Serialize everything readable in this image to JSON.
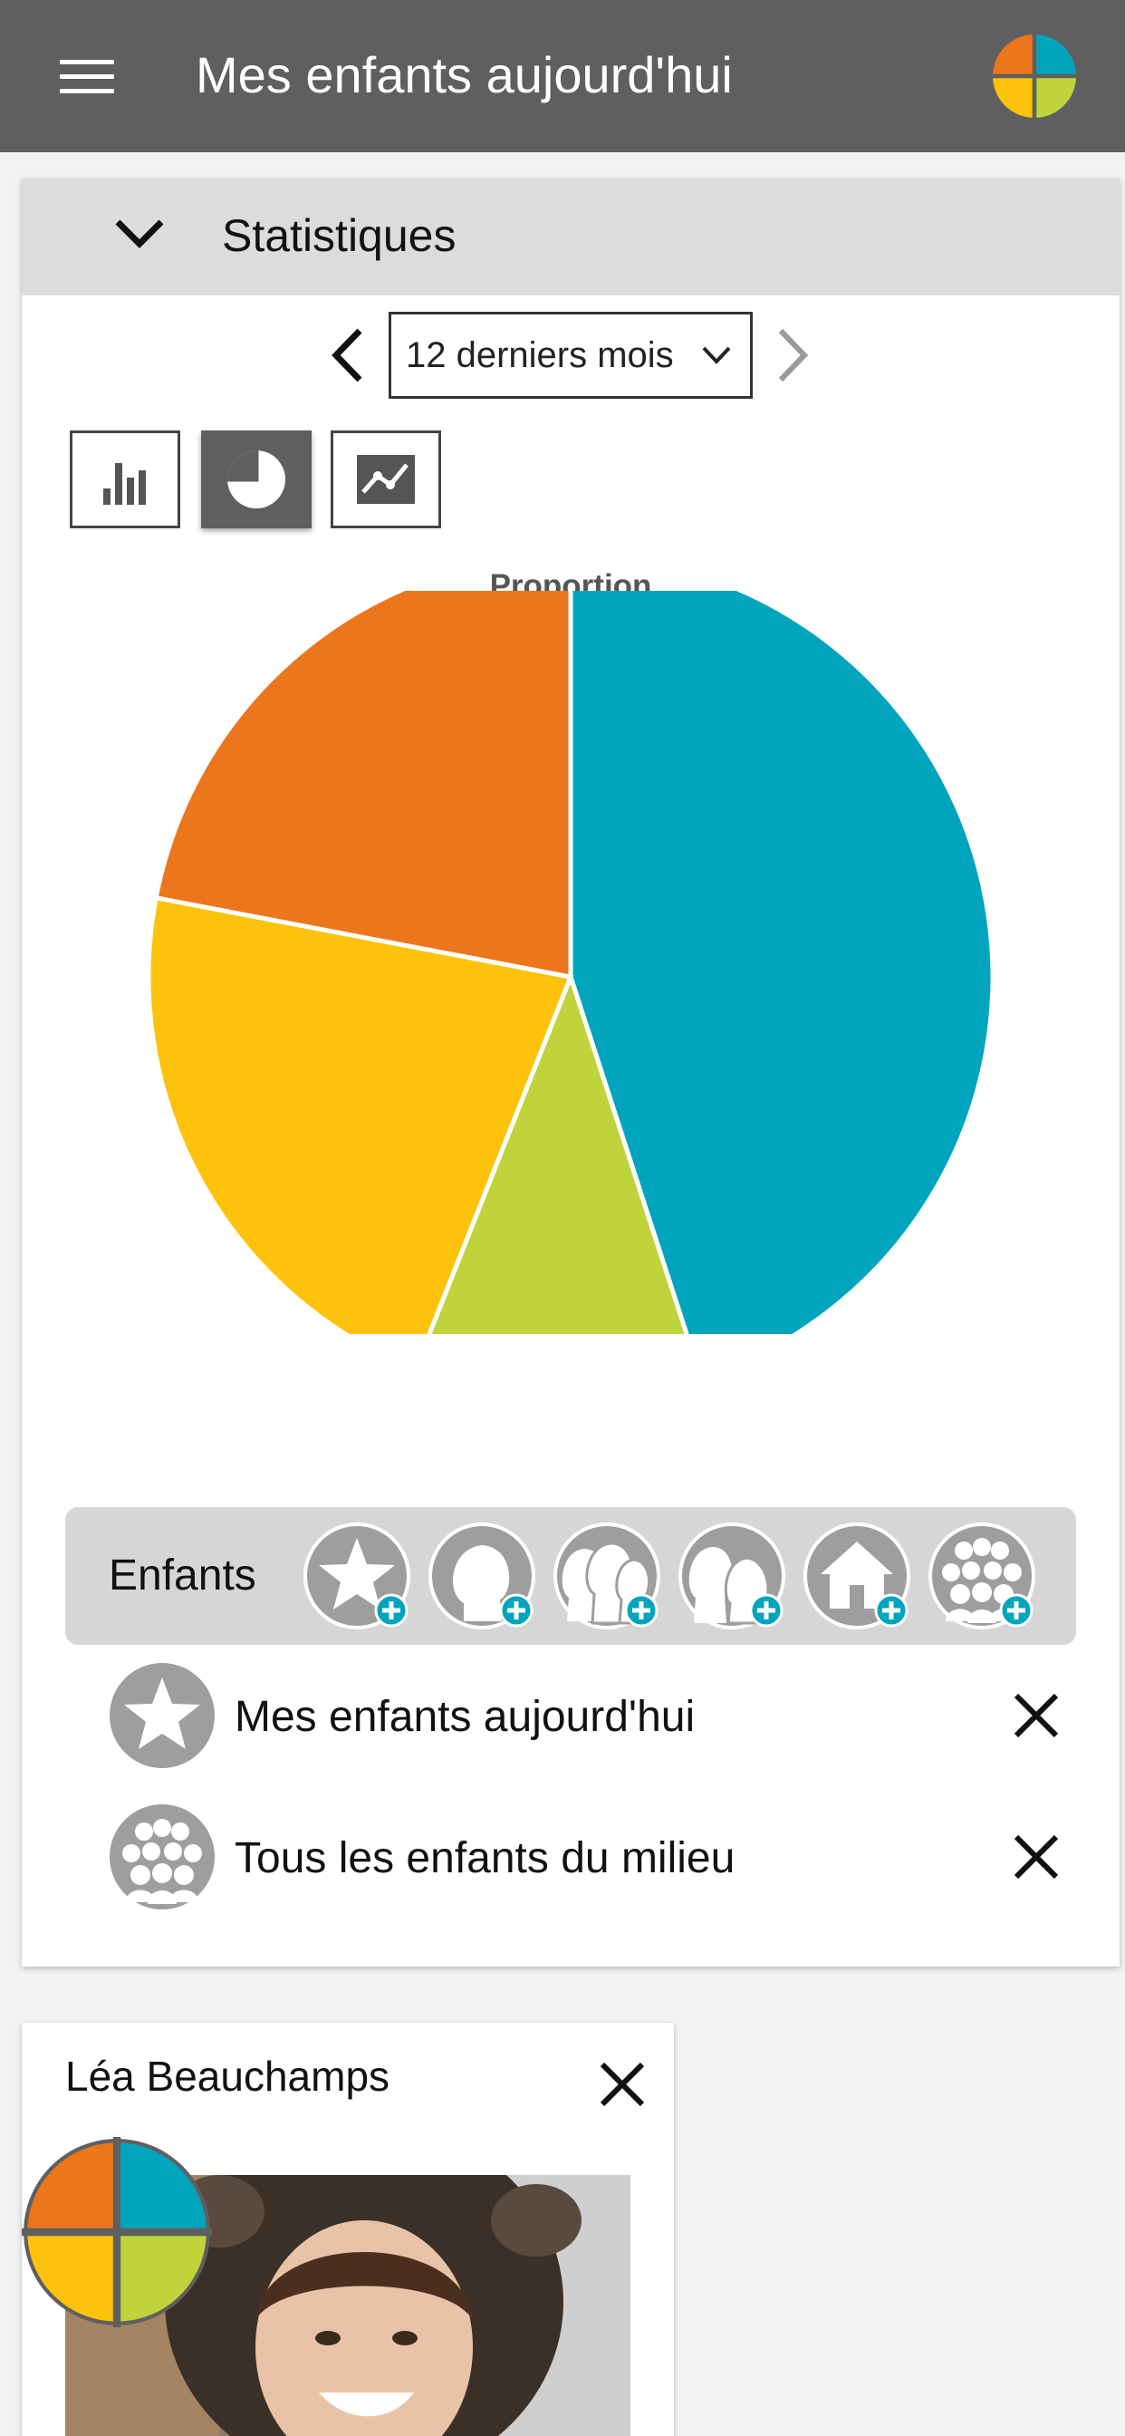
{
  "header": {
    "title": "Mes enfants aujourd'hui"
  },
  "stats": {
    "title": "Statistiques",
    "period": "12 derniers mois",
    "chart_types": [
      "bar-chart",
      "pie-chart",
      "line-chart"
    ],
    "active_chart_type": "pie-chart"
  },
  "chart_data": {
    "type": "pie",
    "title": "Proportion",
    "slices": [
      {
        "value": 45,
        "color": "#00a5bd"
      },
      {
        "value": 11,
        "color": "#bfd43a"
      },
      {
        "value": 22,
        "color": "#fdc20c"
      },
      {
        "value": 22,
        "color": "#ec761c"
      }
    ]
  },
  "filters": {
    "label": "Enfants",
    "icons": [
      "star-plus-icon",
      "child-head-plus-icon",
      "group-heads-plus-icon",
      "boy-girl-plus-icon",
      "house-plus-icon",
      "crowd-plus-icon"
    ],
    "selected": [
      {
        "label": "Mes enfants aujourd'hui",
        "icon": "star-icon"
      },
      {
        "label": "Tous les enfants du milieu",
        "icon": "crowd-icon"
      }
    ]
  },
  "child_card": {
    "name": "Léa Beauchamps"
  },
  "colors": {
    "header_bg": "#5f5f5f",
    "teal": "#00a5bd",
    "green": "#bfd43a",
    "yellow": "#fdc20c",
    "orange": "#ec761c"
  }
}
